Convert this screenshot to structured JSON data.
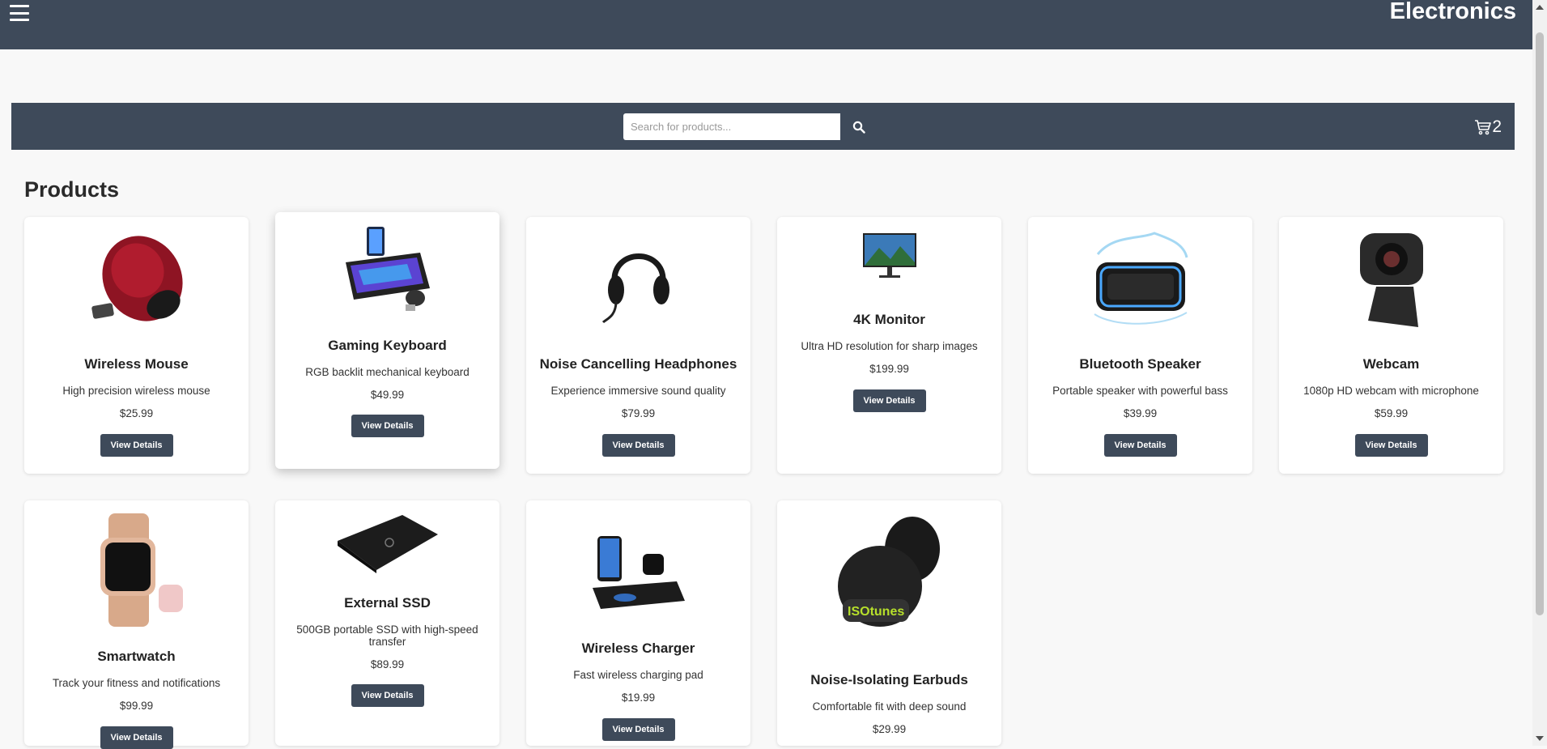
{
  "header": {
    "brand": "Electronics",
    "menu_icon": "hamburger-menu-icon"
  },
  "toolbar": {
    "search_placeholder": "Search for products...",
    "search_icon": "search-icon",
    "cart_icon": "cart-icon",
    "cart_count": "2"
  },
  "main": {
    "title": "Products"
  },
  "products": [
    {
      "name": "Wireless Mouse",
      "description": "High precision wireless mouse",
      "price": "$25.99",
      "button": "View Details"
    },
    {
      "name": "Gaming Keyboard",
      "description": "RGB backlit mechanical keyboard",
      "price": "$49.99",
      "button": "View Details"
    },
    {
      "name": "Noise Cancelling Headphones",
      "description": "Experience immersive sound quality",
      "price": "$79.99",
      "button": "View Details"
    },
    {
      "name": "4K Monitor",
      "description": "Ultra HD resolution for sharp images",
      "price": "$199.99",
      "button": "View Details"
    },
    {
      "name": "Bluetooth Speaker",
      "description": "Portable speaker with powerful bass",
      "price": "$39.99",
      "button": "View Details"
    },
    {
      "name": "Webcam",
      "description": "1080p HD webcam with microphone",
      "price": "$59.99",
      "button": "View Details"
    },
    {
      "name": "Smartwatch",
      "description": "Track your fitness and notifications",
      "price": "$99.99",
      "button": "View Details"
    },
    {
      "name": "External SSD",
      "description": "500GB portable SSD with high-speed transfer",
      "price": "$89.99",
      "button": "View Details"
    },
    {
      "name": "Wireless Charger",
      "description": "Fast wireless charging pad",
      "price": "$19.99",
      "button": "View Details"
    },
    {
      "name": "Noise-Isolating Earbuds",
      "description": "Comfortable fit with deep sound",
      "price": "$29.99",
      "button": "View Details",
      "badge": "ISOtunes"
    }
  ],
  "colors": {
    "primary": "#3e4a5a",
    "background": "#f8f8f8",
    "card": "#ffffff"
  }
}
